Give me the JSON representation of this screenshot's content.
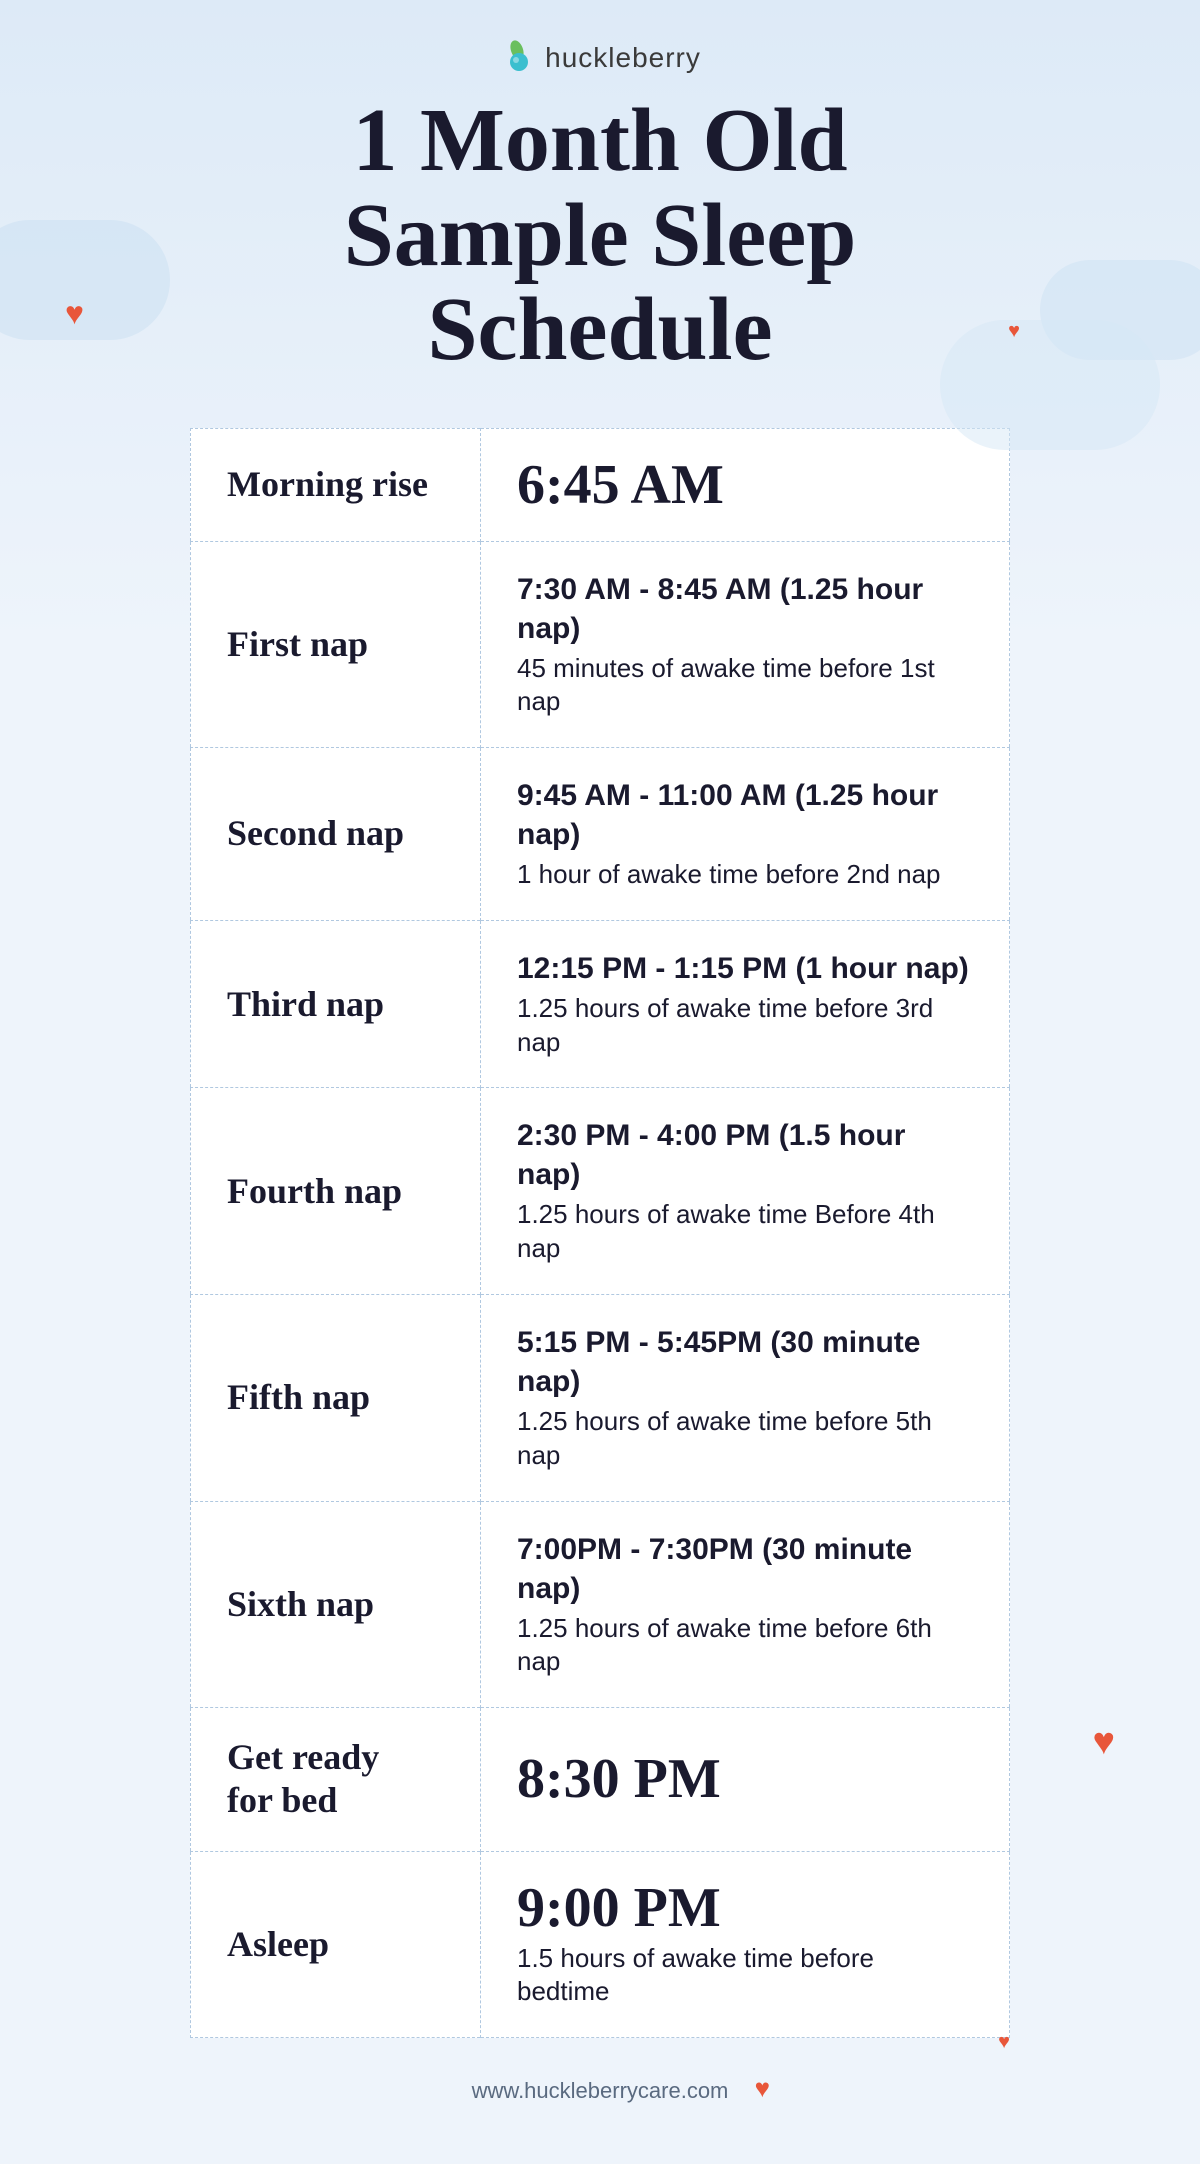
{
  "brand": {
    "logo_text": "huckleberry",
    "footer_url": "www.huckleberrycare.com"
  },
  "header": {
    "title_line1": "1 Month Old",
    "title_line2": "Sample Sleep",
    "title_line3": "Schedule"
  },
  "schedule": {
    "rows": [
      {
        "label": "Morning rise",
        "time_large": "6:45 AM",
        "time_primary": "",
        "time_secondary": ""
      },
      {
        "label": "First nap",
        "time_large": "",
        "time_primary": "7:30 AM - 8:45 AM (1.25 hour nap)",
        "time_secondary": "45 minutes of awake time before 1st nap"
      },
      {
        "label": "Second nap",
        "time_large": "",
        "time_primary": "9:45 AM - 11:00 AM (1.25 hour nap)",
        "time_secondary": "1 hour of awake time before 2nd nap"
      },
      {
        "label": "Third nap",
        "time_large": "",
        "time_primary": "12:15 PM - 1:15 PM (1 hour nap)",
        "time_secondary": "1.25 hours of awake time before 3rd nap"
      },
      {
        "label": "Fourth nap",
        "time_large": "",
        "time_primary": "2:30 PM - 4:00 PM (1.5 hour nap)",
        "time_secondary": "1.25 hours of awake time Before 4th nap"
      },
      {
        "label": "Fifth nap",
        "time_large": "",
        "time_primary": "5:15 PM - 5:45PM (30 minute nap)",
        "time_secondary": "1.25 hours of awake time before 5th nap"
      },
      {
        "label": "Sixth nap",
        "time_large": "",
        "time_primary": "7:00PM - 7:30PM (30 minute nap)",
        "time_secondary": "1.25 hours of awake time before 6th nap"
      },
      {
        "label": "Get ready\nfor bed",
        "time_large": "8:30 PM",
        "time_primary": "",
        "time_secondary": ""
      },
      {
        "label": "Asleep",
        "time_large": "9:00 PM",
        "time_primary": "",
        "time_secondary": "1.5 hours of awake time before bedtime"
      }
    ]
  }
}
